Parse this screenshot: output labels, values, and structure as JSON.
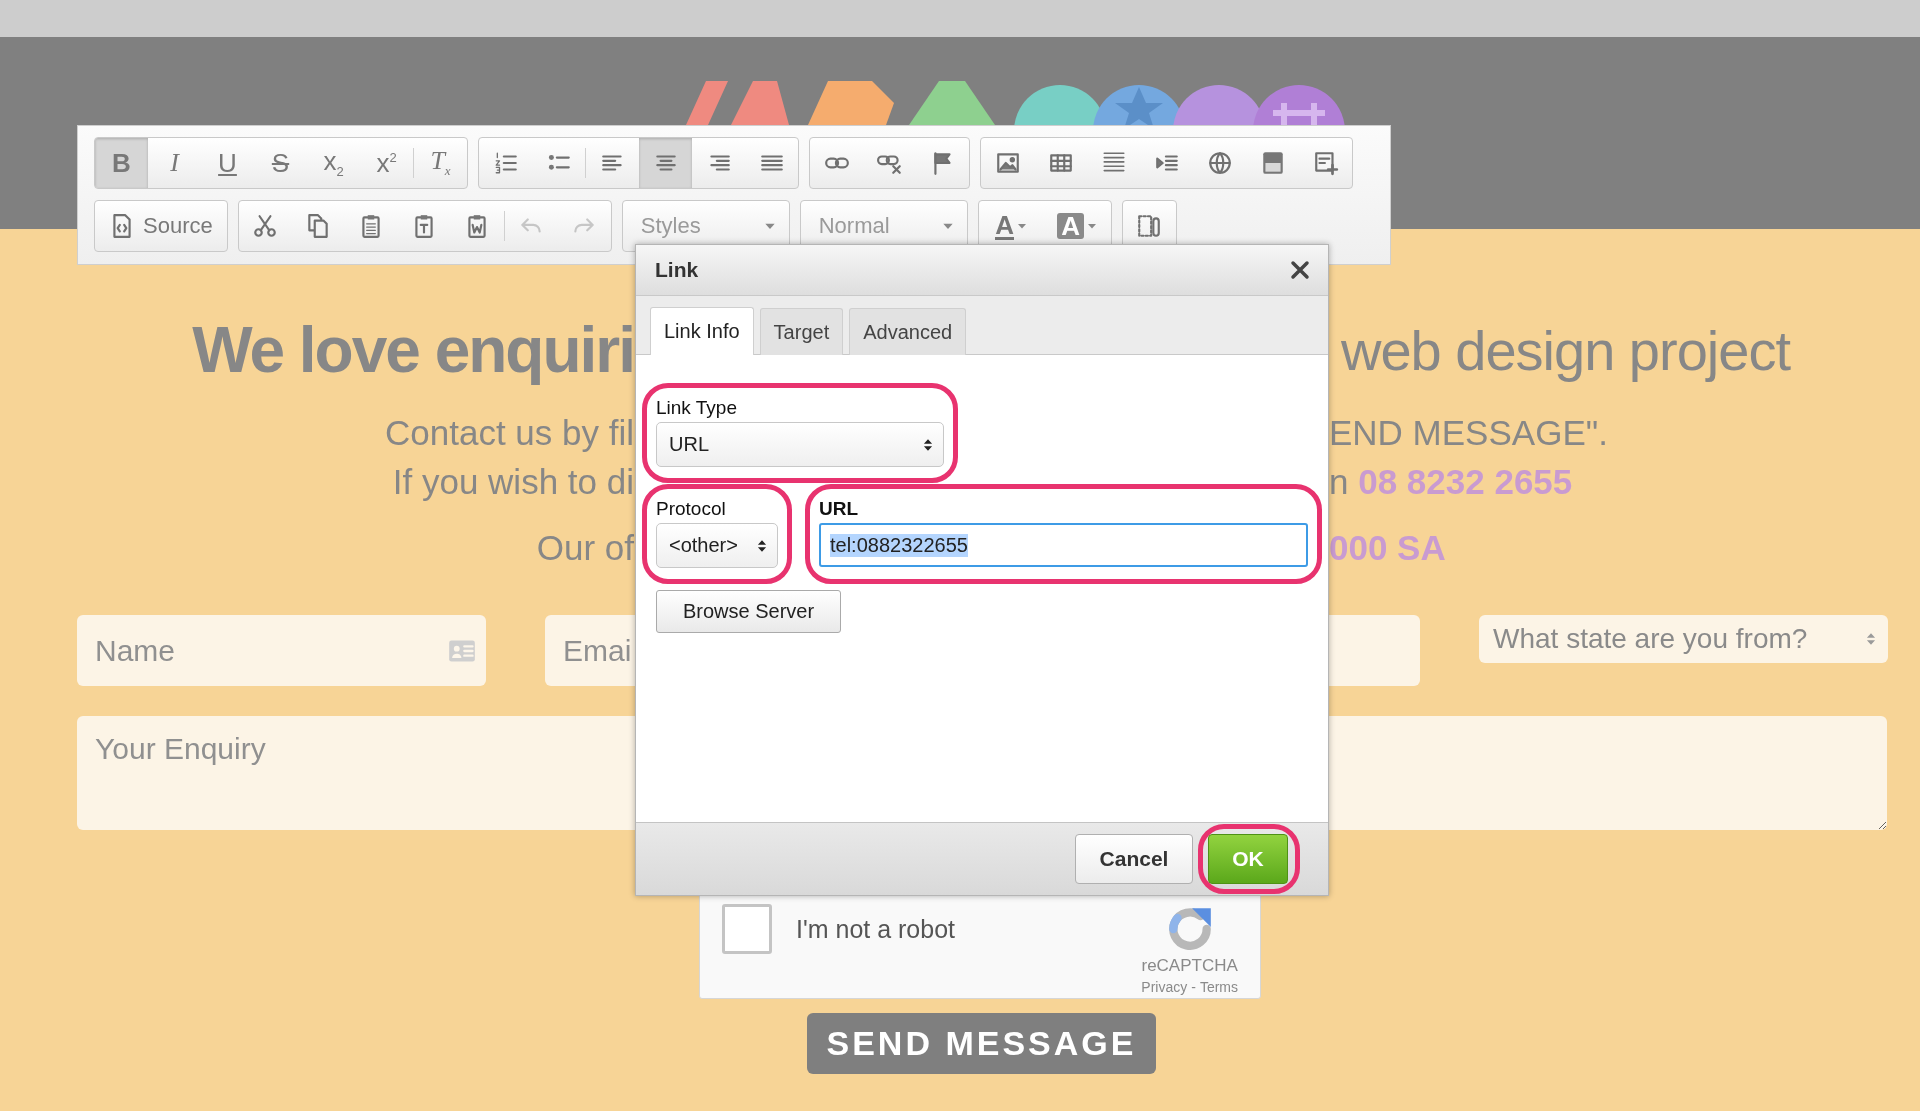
{
  "toolbar": {
    "rows": [
      {
        "groups": [
          {
            "sections": [
              [
                {
                  "kind": "glyph",
                  "glyph": "B",
                  "pressed": true,
                  "disabled": false
                },
                {
                  "kind": "glyph",
                  "glyph": "I",
                  "pressed": false,
                  "disabled": false
                },
                {
                  "kind": "glyph",
                  "glyph": "U",
                  "pressed": false,
                  "disabled": false
                },
                {
                  "kind": "glyph",
                  "glyph": "S",
                  "pressed": false,
                  "disabled": false
                },
                {
                  "kind": "glyph",
                  "glyph": "x$_{2}$",
                  "pressed": false,
                  "disabled": false
                },
                {
                  "kind": "glyph",
                  "glyph": "x$^{2}$",
                  "pressed": false,
                  "disabled": false
                }
              ],
              [
                {
                  "kind": "glyph",
                  "glyph": "T$_{x}$",
                  "pressed": false,
                  "disabled": false
                }
              ]
            ]
          },
          {
            "sections": [
              [
                {
                  "kind": "icon",
                  "pressed": false,
                  "disabled": false
                },
                {
                  "kind": "icon",
                  "pressed": false,
                  "disabled": false
                }
              ],
              [
                {
                  "kind": "icon",
                  "pressed": false,
                  "disabled": false
                },
                {
                  "kind": "icon",
                  "pressed": true,
                  "disabled": false
                },
                {
                  "kind": "icon",
                  "pressed": false,
                  "disabled": false
                },
                {
                  "kind": "icon",
                  "pressed": false,
                  "disabled": false
                }
              ]
            ]
          },
          {
            "sections": [
              [
                {
                  "kind": "icon",
                  "pressed": false,
                  "disabled": false
                },
                {
                  "kind": "icon",
                  "pressed": false,
                  "disabled": false
                },
                {
                  "kind": "icon",
                  "pressed": false,
                  "disabled": false
                }
              ]
            ]
          },
          {
            "sections": [
              [
                {
                  "kind": "icon",
                  "pressed": false,
                  "disabled": false
                },
                {
                  "kind": "icon",
                  "pressed": false,
                  "disabled": false
                },
                {
                  "kind": "icon",
                  "pressed": false,
                  "disabled": false
                },
                {
                  "kind": "icon",
                  "pressed": false,
                  "disabled": false
                },
                {
                  "kind": "icon",
                  "pressed": false,
                  "disabled": false
                },
                {
                  "kind": "icon",
                  "pressed": false,
                  "disabled": false
                },
                {
                  "kind": "icon",
                  "pressed": false,
                  "disabled": false
                }
              ]
            ]
          }
        ]
      },
      {
        "groups": [
          {
            "sections": [
              [
                {
                  "kind": "labeled",
                  "label": "Source",
                  "pressed": false,
                  "disabled": false
                }
              ]
            ]
          },
          {
            "sections": [
              [
                {
                  "kind": "icon",
                  "pressed": false,
                  "disabled": false
                },
                {
                  "kind": "icon",
                  "pressed": false,
                  "disabled": false
                },
                {
                  "kind": "icon",
                  "pressed": false,
                  "disabled": false
                },
                {
                  "kind": "icon",
                  "pressed": false,
                  "disabled": false
                },
                {
                  "kind": "icon",
                  "pressed": false,
                  "disabled": false
                }
              ],
              [
                {
                  "kind": "icon",
                  "pressed": false,
                  "disabled": true
                },
                {
                  "kind": "icon",
                  "pressed": false,
                  "disabled": true
                }
              ]
            ]
          },
          {
            "sections": [
              [
                {
                  "kind": "combo",
                  "label": "Styles",
                  "pressed": false,
                  "disabled": false
                }
              ]
            ]
          },
          {
            "sections": [
              [
                {
                  "kind": "combo",
                  "label": "Normal",
                  "pressed": false,
                  "disabled": false
                }
              ]
            ]
          },
          {
            "sections": [
              [
                {
                  "kind": "text-color",
                  "glyph": "A",
                  "pressed": false,
                  "disabled": false
                },
                {
                  "kind": "bg-color",
                  "glyph": "A",
                  "pressed": false,
                  "disabled": false
                }
              ]
            ]
          },
          {
            "sections": [
              [
                {
                  "kind": "icon",
                  "pressed": false,
                  "disabled": false
                }
              ]
            ]
          }
        ]
      }
    ]
  },
  "page": {
    "heading_left": "We love enquiri",
    "heading_right": "web design project",
    "lines": [
      {
        "left": "Contact us by fil",
        "right": "END MESSAGE\".",
        "kind": "plain"
      },
      {
        "left": "If you wish to di",
        "right": "n **08 8232 2655**",
        "kind": "plain"
      },
      {
        "left": "Our of",
        "right": "000 SA",
        "kind": "accent"
      }
    ]
  },
  "form": {
    "fields": [
      {
        "kind": "contact",
        "placeholder": "Name"
      },
      {
        "kind": "text",
        "placeholder": "Emai"
      },
      {
        "kind": "select",
        "placeholder": "What state are you from?"
      }
    ],
    "enquiry": {
      "placeholder": "Your Enquiry"
    },
    "captcha": {
      "label": "I'm not a robot",
      "checked": false,
      "brand": "reCAPTCHA",
      "links": [
        "Privacy",
        "Terms"
      ],
      "link_separator": "-"
    },
    "submit": "SEND MESSAGE"
  },
  "dialog": {
    "title": "Link",
    "tabs": [
      {
        "label": "Link Info",
        "selected": true
      },
      {
        "label": "Target",
        "selected": false
      },
      {
        "label": "Advanced",
        "selected": false
      }
    ],
    "link_type": {
      "label": "Link Type",
      "value": "URL",
      "highlighted": true
    },
    "protocol": {
      "label": "Protocol",
      "value": "<other>",
      "highlighted": true
    },
    "url": {
      "label": "URL",
      "value": "tel:0882322655",
      "focused": true,
      "text_selected": true,
      "highlighted": true
    },
    "browse_button": "Browse Server",
    "buttons": [
      {
        "label": "Cancel",
        "kind": "default",
        "highlighted": false
      },
      {
        "label": "OK",
        "kind": "primary",
        "highlighted": true
      }
    ]
  }
}
